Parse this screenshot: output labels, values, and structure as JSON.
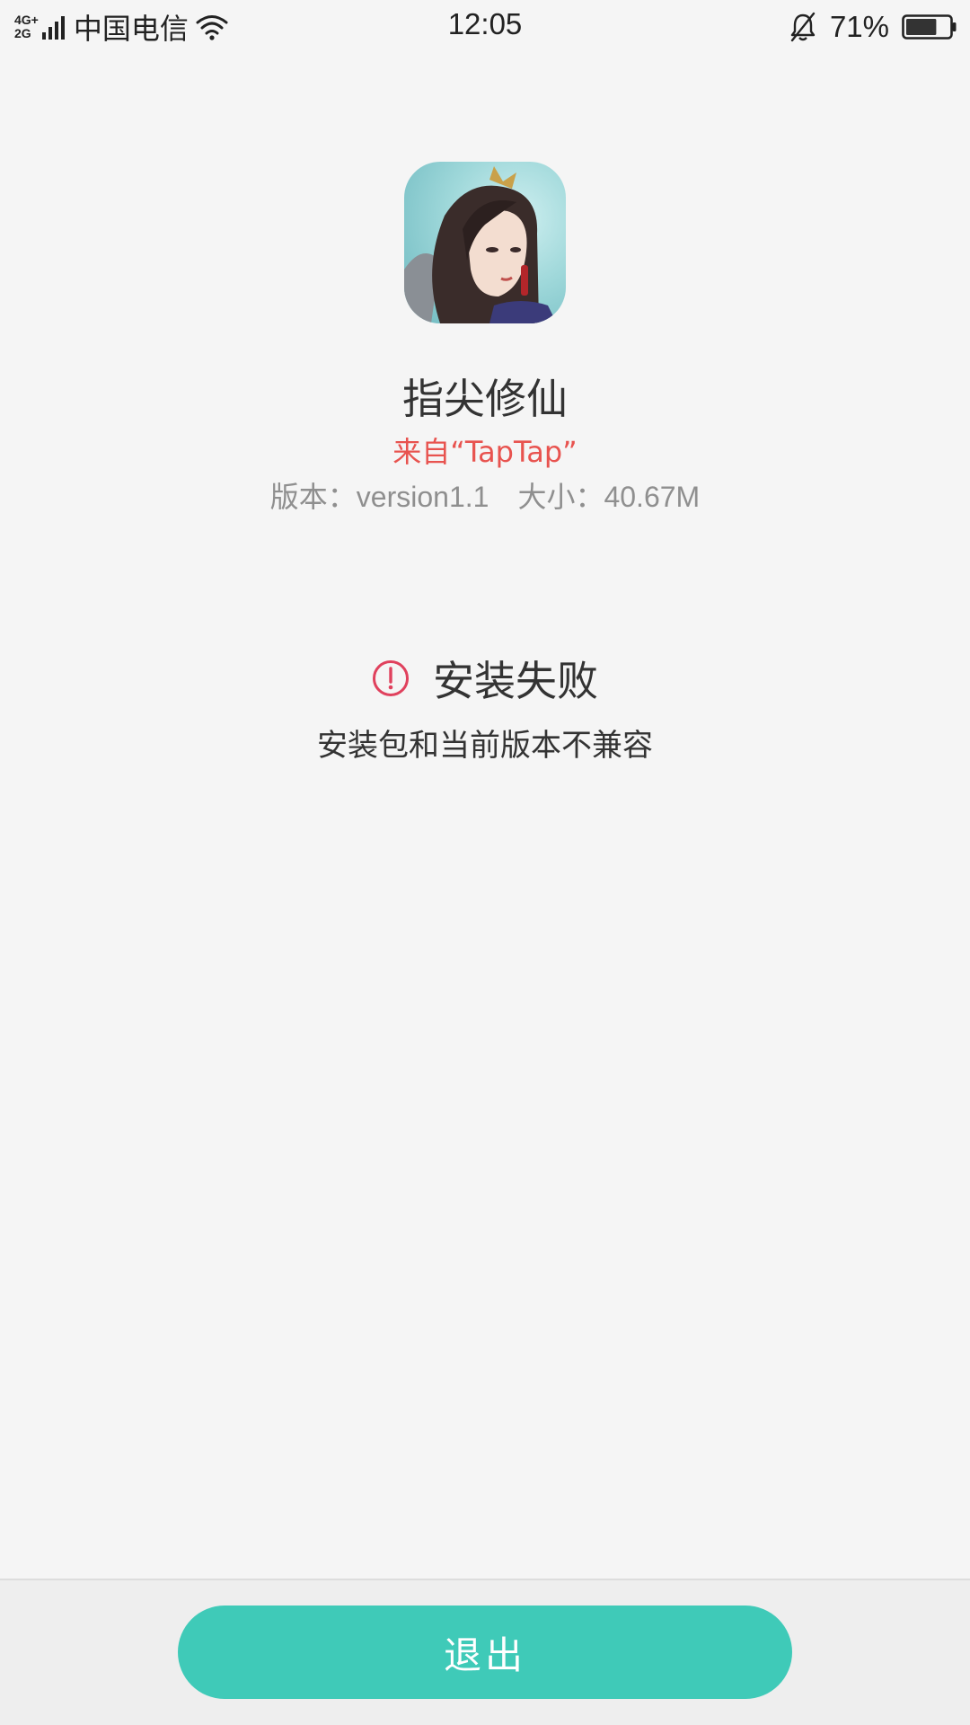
{
  "status_bar": {
    "network_top": "4G+",
    "network_bottom": "2G",
    "carrier": "中国电信",
    "time": "12:05",
    "battery_percent": "71%",
    "battery_level": 0.71,
    "icons": [
      "signal-icon",
      "wifi-icon",
      "bell-off-icon",
      "battery-icon"
    ]
  },
  "app": {
    "icon": "app-icon",
    "name": "指尖修仙",
    "source": "来自“TapTap”",
    "version_label": "版本：version1.1",
    "size_label": "大小：40.67M"
  },
  "result": {
    "icon": "error-icon",
    "title": "安装失败",
    "message": "安装包和当前版本不兼容"
  },
  "actions": {
    "exit_label": "退出"
  },
  "colors": {
    "accent": "#3fcab8",
    "source_text": "#e8534f",
    "error_icon": "#e0415d",
    "background": "#f5f5f5"
  }
}
